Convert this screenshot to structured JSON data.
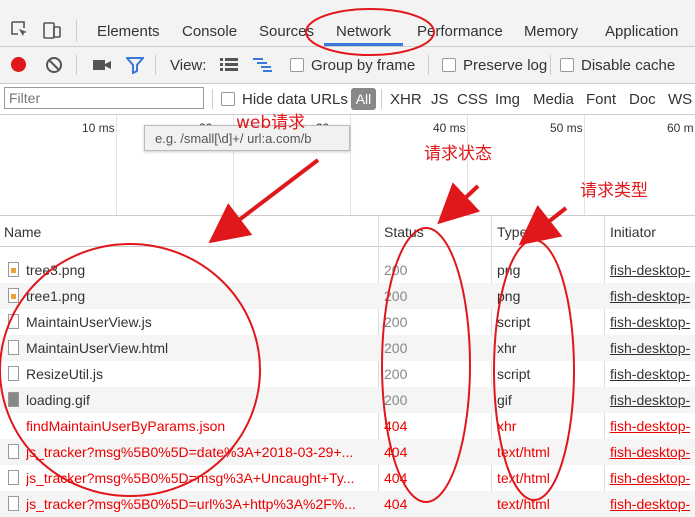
{
  "tabs": {
    "elements": "Elements",
    "console": "Console",
    "sources": "Sources",
    "network": "Network",
    "performance": "Performance",
    "memory": "Memory",
    "application": "Application"
  },
  "toolbar": {
    "view_label": "View:",
    "group_by_frame": "Group by frame",
    "preserve_log": "Preserve log",
    "disable_cache": "Disable cache"
  },
  "filterbar": {
    "placeholder": "Filter",
    "hide_data_urls": "Hide data URLs",
    "types": [
      "All",
      "XHR",
      "JS",
      "CSS",
      "Img",
      "Media",
      "Font",
      "Doc",
      "WS"
    ]
  },
  "timeline": {
    "ticks": [
      "10 ms",
      "20 ms",
      "30 ms",
      "40 ms",
      "50 ms",
      "60 m"
    ],
    "tooltip": "e.g. /small[\\d]+/ url:a.com/b"
  },
  "columns": {
    "name": "Name",
    "status": "Status",
    "type": "Type",
    "initiator": "Initiator"
  },
  "requests": [
    {
      "name": "tree3.png",
      "status": "200",
      "type": "png",
      "initiator": "fish-desktop-",
      "icon": "image-file-icon",
      "error": false
    },
    {
      "name": "tree1.png",
      "status": "200",
      "type": "png",
      "initiator": "fish-desktop-",
      "icon": "image-file-icon",
      "error": false
    },
    {
      "name": "MaintainUserView.js",
      "status": "200",
      "type": "script",
      "initiator": "fish-desktop-",
      "icon": "file-icon",
      "error": false
    },
    {
      "name": "MaintainUserView.html",
      "status": "200",
      "type": "xhr",
      "initiator": "fish-desktop-",
      "icon": "file-icon",
      "error": false
    },
    {
      "name": "ResizeUtil.js",
      "status": "200",
      "type": "script",
      "initiator": "fish-desktop-",
      "icon": "file-icon",
      "error": false
    },
    {
      "name": "loading.gif",
      "status": "200",
      "type": "gif",
      "initiator": "fish-desktop-",
      "icon": "gif-file-icon",
      "error": false
    },
    {
      "name": "findMaintainUserByParams.json",
      "status": "404",
      "type": "xhr",
      "initiator": "fish-desktop-",
      "icon": "none",
      "error": true
    },
    {
      "name": "js_tracker?msg%5B0%5D=date%3A+2018-03-29+...",
      "status": "404",
      "type": "text/html",
      "initiator": "fish-desktop-",
      "icon": "file-icon",
      "error": true
    },
    {
      "name": "js_tracker?msg%5B0%5D=msg%3A+Uncaught+Ty...",
      "status": "404",
      "type": "text/html",
      "initiator": "fish-desktop-",
      "icon": "file-icon",
      "error": true
    },
    {
      "name": "js_tracker?msg%5B0%5D=url%3A+http%3A%2F%...",
      "status": "404",
      "type": "text/html",
      "initiator": "fish-desktop-",
      "icon": "file-icon",
      "error": true
    }
  ],
  "annotations": {
    "web_requests": "web请求",
    "request_status": "请求状态",
    "request_type": "请求类型"
  },
  "colors": {
    "annotation": "#e0171b",
    "record": "#e0171b",
    "accent": "#3879d9",
    "error": "#e00"
  }
}
